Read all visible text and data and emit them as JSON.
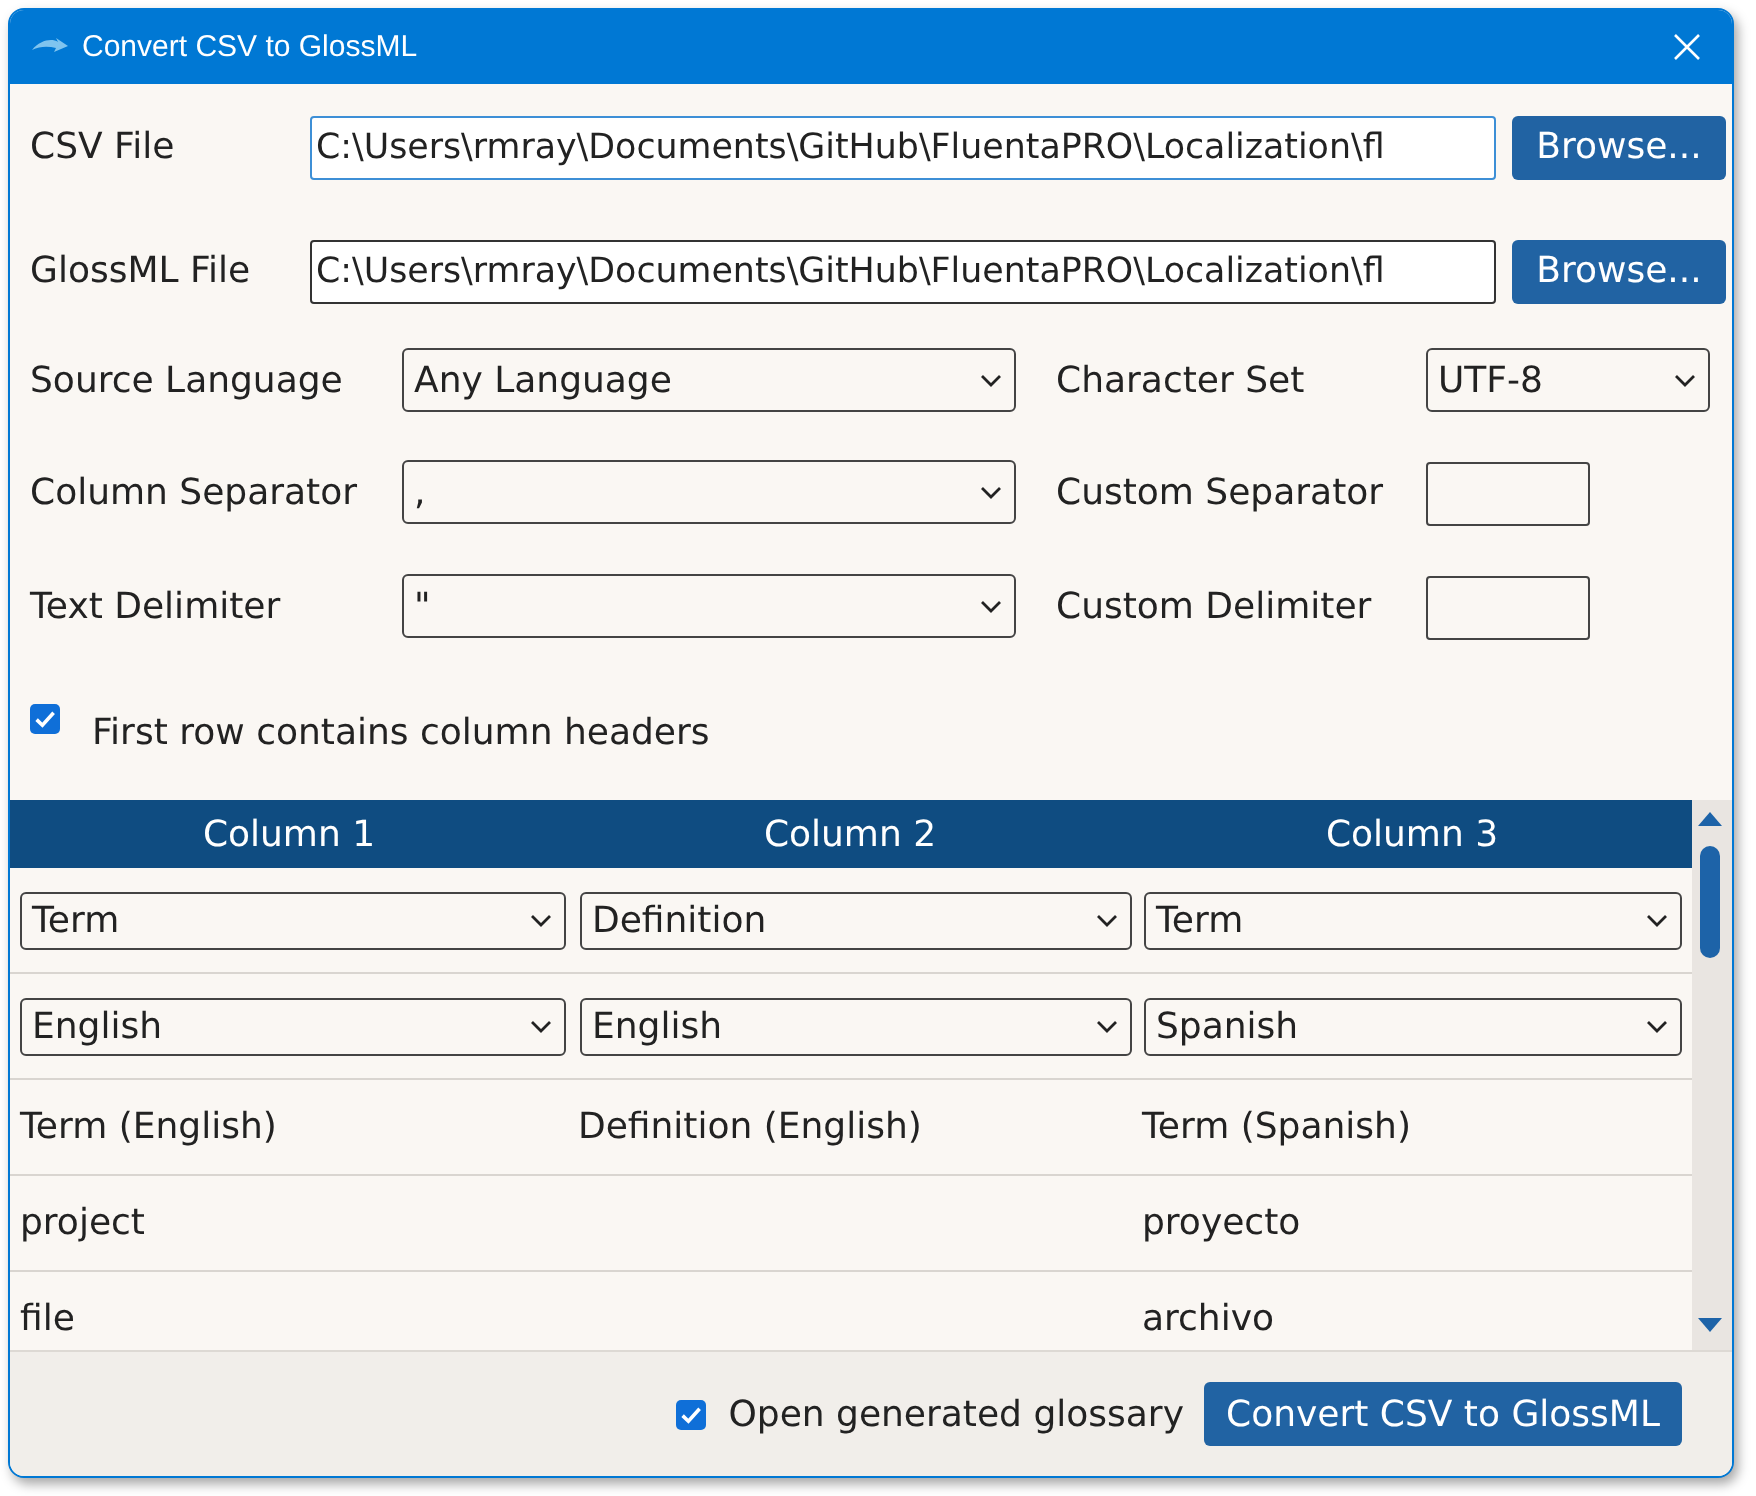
{
  "window": {
    "title": "Convert CSV to GlossML"
  },
  "files": [
    {
      "label": "CSV File",
      "value": "C:\\Users\\rmray\\Documents\\GitHub\\FluentaPRO\\Localization\\fl",
      "focused": true,
      "button": "Browse..."
    },
    {
      "label": "GlossML File",
      "value": "C:\\Users\\rmray\\Documents\\GitHub\\FluentaPRO\\Localization\\fl",
      "focused": false,
      "button": "Browse..."
    }
  ],
  "settings": [
    {
      "label": "Source Language",
      "kind": "select",
      "value": "Any Language"
    },
    {
      "label": "Character Set",
      "kind": "select",
      "value": "UTF-8"
    },
    {
      "label": "Column Separator",
      "kind": "select",
      "value": ","
    },
    {
      "label": "Custom Separator",
      "kind": "input"
    },
    {
      "label": "Text Delimiter",
      "kind": "select",
      "value": "\""
    },
    {
      "label": "Custom Delimiter",
      "kind": "input"
    }
  ],
  "header_option": {
    "label": "First row contains column headers",
    "checked": true
  },
  "grid": {
    "columns": [
      {
        "header": "Column 1",
        "type": "Term",
        "language": "English"
      },
      {
        "header": "Column 2",
        "type": "Definition",
        "language": "English"
      },
      {
        "header": "Column 3",
        "type": "Term",
        "language": "Spanish"
      }
    ],
    "rows": [
      {
        "column_1": "Term (English)",
        "column_2": "Definition (English)",
        "column_3": "Term (Spanish)"
      },
      {
        "column_1": "project",
        "column_3": "proyecto"
      },
      {
        "column_1": "file",
        "column_3": "archivo"
      }
    ]
  },
  "footer": {
    "open_glossary": {
      "label": "Open generated glossary",
      "checked": true
    },
    "button": "Convert CSV to GlossML"
  }
}
